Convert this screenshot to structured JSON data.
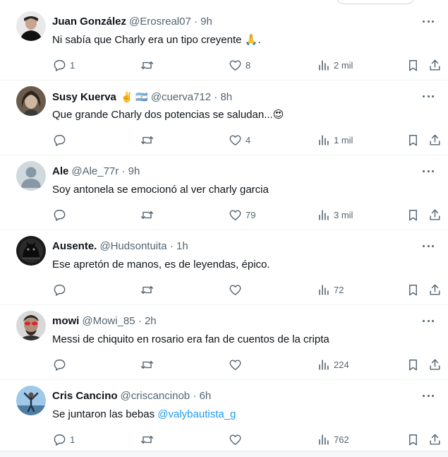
{
  "tweets": [
    {
      "name": "Juan González",
      "flags": "",
      "handle": "@Erosreal07",
      "sep": "·",
      "time": "9h",
      "text": "Ni sabía que Charly era un tipo creyente",
      "text_emoji": "🙏",
      "text_tail": ".",
      "mention": "",
      "replies": "1",
      "retweets": "",
      "likes": "8",
      "views": "2 mil",
      "avatar": "dark-hair-man"
    },
    {
      "name": "Susy Kuerva",
      "flags": "✌️ 🇦🇷",
      "handle": "@cuerva712",
      "sep": "·",
      "time": "8h",
      "text": "Que grande Charly dos potencias se saludan...",
      "text_emoji": "😍",
      "text_tail": "",
      "mention": "",
      "replies": "",
      "retweets": "",
      "likes": "4",
      "views": "1 mil",
      "avatar": "woman-portrait"
    },
    {
      "name": "Ale",
      "flags": "",
      "handle": "@Ale_77r",
      "sep": "·",
      "time": "9h",
      "text": "Soy antonela se emocionó al ver charly garcia",
      "text_emoji": "",
      "text_tail": "",
      "mention": "",
      "replies": "",
      "retweets": "",
      "likes": "79",
      "views": "3 mil",
      "avatar": "default-person"
    },
    {
      "name": "Ausente.",
      "flags": "",
      "handle": "@Hudsontuita",
      "sep": "·",
      "time": "1h",
      "text": "Ese apretón de manos, es de leyendas, épico.",
      "text_emoji": "",
      "text_tail": "",
      "mention": "",
      "replies": "",
      "retweets": "",
      "likes": "",
      "views": "72",
      "avatar": "dark-cat"
    },
    {
      "name": "mowi",
      "flags": "",
      "handle": "@Mowi_85",
      "sep": "·",
      "time": "2h",
      "text": "Messi de chiquito en rosario era fan de cuentos de la cripta",
      "text_emoji": "",
      "text_tail": "",
      "mention": "",
      "replies": "",
      "retweets": "",
      "likes": "",
      "views": "224",
      "avatar": "red-eyes"
    },
    {
      "name": "Cris Cancino",
      "flags": "",
      "handle": "@criscancinob",
      "sep": "·",
      "time": "6h",
      "text": "Se juntaron las bebas",
      "text_emoji": "",
      "text_tail": "",
      "mention": "@valybautista_g",
      "replies": "1",
      "retweets": "",
      "likes": "",
      "views": "762",
      "avatar": "sky-figure"
    }
  ],
  "icons": {
    "reply": "reply-icon",
    "retweet": "retweet-icon",
    "like": "heart-icon",
    "views": "views-chart-icon",
    "bookmark": "bookmark-icon",
    "share": "share-icon",
    "more": "more-icon"
  },
  "colors": {
    "text": "#0f1419",
    "muted": "#536471",
    "link": "#1d9bf0",
    "divider": "#eff3f4"
  }
}
